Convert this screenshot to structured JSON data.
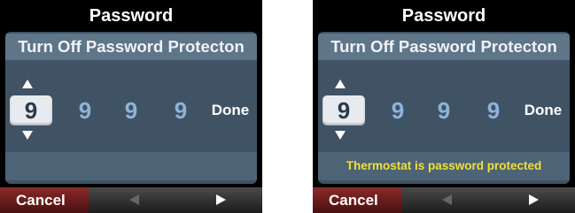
{
  "screens": [
    {
      "title": "Password",
      "heading": "Turn Off Password Protecton",
      "digits": [
        "9",
        "9",
        "9",
        "9"
      ],
      "done_label": "Done",
      "status_message": "",
      "cancel_label": "Cancel"
    },
    {
      "title": "Password",
      "heading": "Turn Off Password Protecton",
      "digits": [
        "9",
        "9",
        "9",
        "9"
      ],
      "done_label": "Done",
      "status_message": "Thermostat is password protected",
      "cancel_label": "Cancel"
    }
  ],
  "colors": {
    "panel_background": "#3f5364",
    "heading_background": "#5f7588",
    "digit_inactive": "#8fb3d8",
    "digit_selected_background": "#e7ebef",
    "status_text": "#f0e03a",
    "cancel_background": "#8a2a2a"
  },
  "icons": {
    "increment": "triangle-up-icon",
    "decrement": "triangle-down-icon",
    "nav_left": "triangle-left-icon",
    "nav_right": "triangle-right-icon"
  }
}
